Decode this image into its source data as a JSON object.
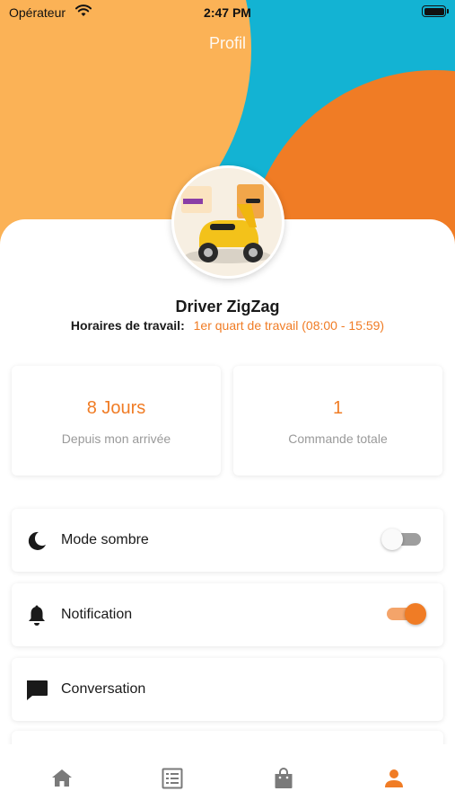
{
  "status_bar": {
    "carrier": "Opérateur",
    "time": "2:47 PM"
  },
  "header": {
    "title": "Profil"
  },
  "profile": {
    "name": "Driver ZigZag",
    "schedule_label": "Horaires de travail:",
    "schedule_value": "1er quart de travail (08:00 - 15:59)"
  },
  "stats": [
    {
      "value": "8 Jours",
      "label": "Depuis mon arrivée"
    },
    {
      "value": "1",
      "label": "Commande totale"
    }
  ],
  "menu": [
    {
      "label": "Mode sombre",
      "icon": "moon-icon",
      "toggle": "off"
    },
    {
      "label": "Notification",
      "icon": "bell-icon",
      "toggle": "on"
    },
    {
      "label": "Conversation",
      "icon": "chat-icon"
    }
  ],
  "bottom_nav": {
    "items": [
      {
        "icon": "home-icon",
        "active": false
      },
      {
        "icon": "list-icon",
        "active": false
      },
      {
        "icon": "bag-icon",
        "active": false
      },
      {
        "icon": "profile-icon",
        "active": true
      }
    ]
  },
  "colors": {
    "accent": "#f07c25",
    "header_cyan": "#13b3d3",
    "header_yellow": "#fbb256",
    "nav_inactive": "#7a7a7a"
  }
}
